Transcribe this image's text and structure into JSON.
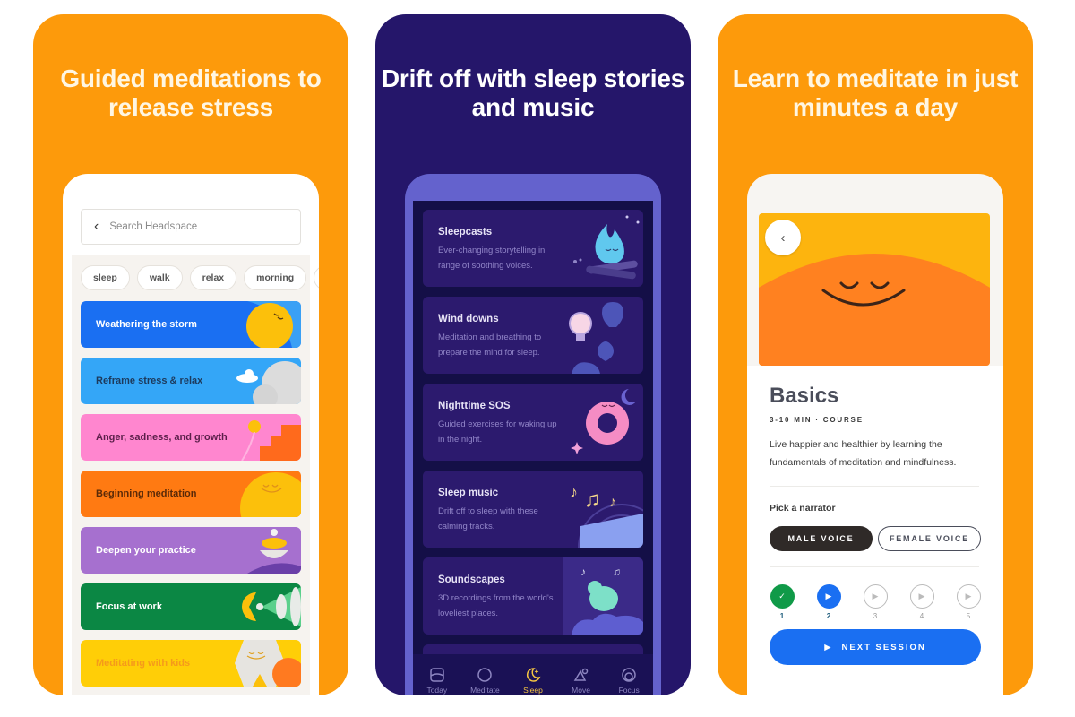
{
  "panels": [
    {
      "headline": "Guided meditations to release stress",
      "background": "#fd9a0b",
      "search": {
        "placeholder": "Search Headspace"
      },
      "chips": [
        "sleep",
        "walk",
        "relax",
        "morning"
      ],
      "categories": [
        {
          "label": "Weathering the storm",
          "bg": "#1a6ff2",
          "color": "#ffffff"
        },
        {
          "label": "Reframe stress & relax",
          "bg": "#34a6f7",
          "color": "#1d3a5c"
        },
        {
          "label": "Anger, sadness, and growth",
          "bg": "#ff86cf",
          "color": "#5b1f4a"
        },
        {
          "label": "Beginning meditation",
          "bg": "#ff7a12",
          "color": "#5a2a08"
        },
        {
          "label": "Deepen your practice",
          "bg": "#a670cf",
          "color": "#ffffff"
        },
        {
          "label": "Focus at work",
          "bg": "#0b8744",
          "color": "#ffffff"
        },
        {
          "label": "Meditating with kids",
          "bg": "#ffce07",
          "color": "#f59a1b"
        }
      ]
    },
    {
      "headline": "Drift off with sleep stories and music",
      "background": "#25166a",
      "cards": [
        {
          "title": "Sleepcasts",
          "desc": "Ever-changing storytelling in range of soothing voices."
        },
        {
          "title": "Wind downs",
          "desc": "Meditation and breathing to prepare the mind for sleep."
        },
        {
          "title": "Nighttime SOS",
          "desc": "Guided exercises for waking up in the night."
        },
        {
          "title": "Sleep music",
          "desc": "Drift off to sleep with these calming tracks."
        },
        {
          "title": "Soundscapes",
          "desc": "3D recordings from the world's loveliest places."
        }
      ],
      "tabs": [
        {
          "label": "Today",
          "icon": "today-icon"
        },
        {
          "label": "Meditate",
          "icon": "meditate-icon"
        },
        {
          "label": "Sleep",
          "icon": "sleep-moon-icon",
          "active": true
        },
        {
          "label": "Move",
          "icon": "move-icon"
        },
        {
          "label": "Focus",
          "icon": "focus-icon"
        }
      ],
      "active_tab_color": "#f5c542"
    },
    {
      "headline": "Learn to meditate in just minutes a day",
      "background": "#fd9a0b",
      "course": {
        "title": "Basics",
        "meta": "3-10 MIN · COURSE",
        "description": "Live happier and healthier by learning the fundamentals of meditation and mindfulness."
      },
      "narrator": {
        "label": "Pick a narrator",
        "options": [
          "MALE VOICE",
          "FEMALE VOICE"
        ],
        "selected": "MALE VOICE"
      },
      "sessions": [
        {
          "number": "1",
          "state": "done"
        },
        {
          "number": "2",
          "state": "current"
        },
        {
          "number": "3",
          "state": "locked"
        },
        {
          "number": "4",
          "state": "locked"
        },
        {
          "number": "5",
          "state": "locked"
        }
      ],
      "next_button": "NEXT SESSION",
      "accent": "#1a6ff2"
    }
  ]
}
